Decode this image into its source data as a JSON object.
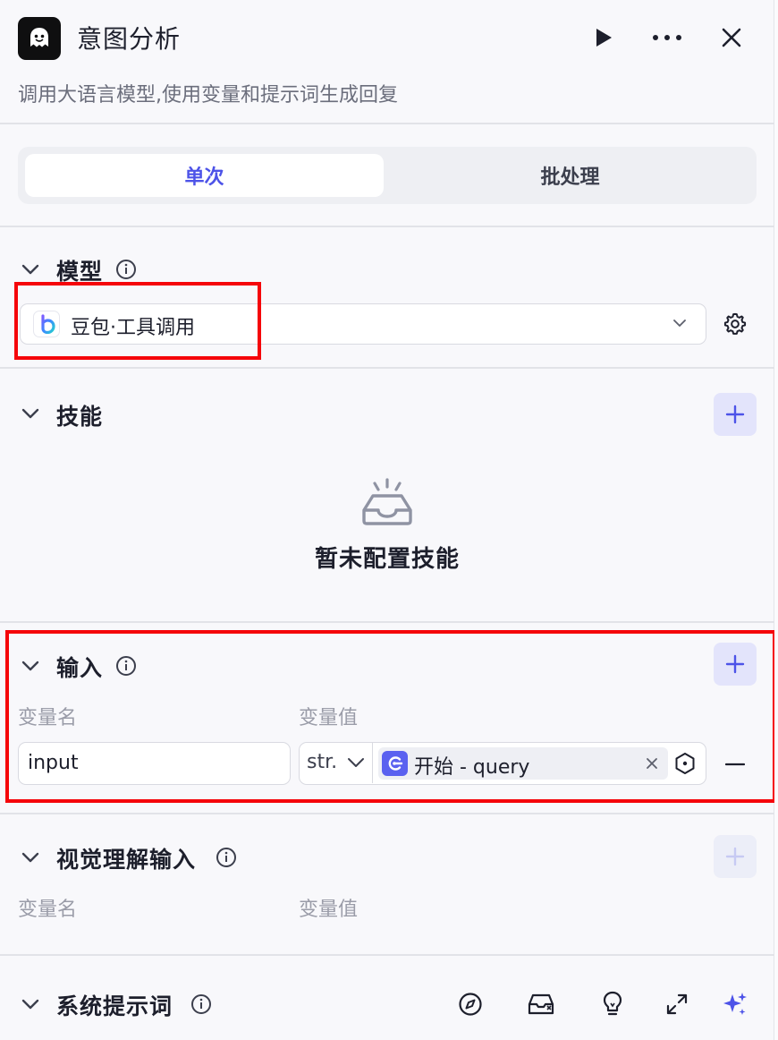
{
  "header": {
    "title": "意图分析",
    "subtitle": "调用大语言模型,使用变量和提示词生成回复",
    "app_icon": "ghost-icon",
    "buttons": [
      "play-icon",
      "more-icon",
      "close-icon"
    ]
  },
  "mode_tabs": [
    {
      "label": "单次",
      "active": true
    },
    {
      "label": "批处理",
      "active": false
    }
  ],
  "model_section": {
    "title": "模型",
    "selected_model": "豆包·工具调用",
    "model_icon": "doubao-logo-icon",
    "settings_icon": "gear-icon"
  },
  "skills_section": {
    "title": "技能",
    "empty_text": "暂未配置技能",
    "empty_icon": "inbox-icon"
  },
  "input_section": {
    "title": "输入",
    "col_name": "变量名",
    "col_value": "变量值",
    "rows": [
      {
        "name": "input",
        "type": "str.",
        "ref_node": "开始",
        "ref_var": "query",
        "ref_display": "开始 - query"
      }
    ]
  },
  "vision_section": {
    "title": "视觉理解输入",
    "col_name": "变量名",
    "col_value": "变量值"
  },
  "prompt_section": {
    "title": "系统提示词",
    "tools": [
      "compass-icon",
      "library-icon",
      "lightbulb-icon",
      "expand-icon",
      "sparkle-icon"
    ]
  },
  "colors": {
    "accent": "#4d53e8",
    "highlight_box": "#f5050a",
    "background": "#f8f8fb"
  }
}
